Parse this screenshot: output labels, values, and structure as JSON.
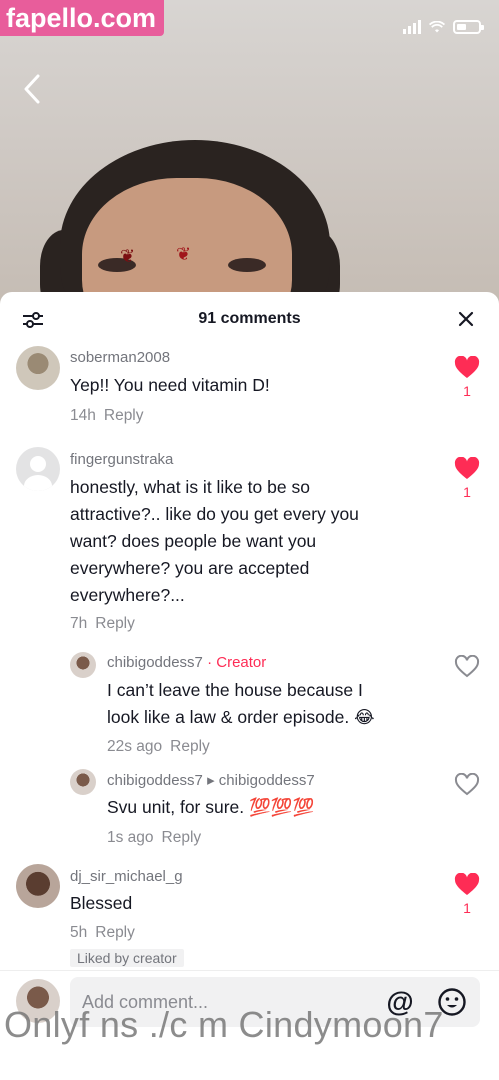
{
  "watermark_top": "fapello.com",
  "watermark_bottom": "Onlyf ns ./c m Cindymoon7",
  "header": {
    "title": "91 comments"
  },
  "comments": [
    {
      "username": "soberman2008",
      "text_lines": [
        "Yep!! You need vitamin D!"
      ],
      "time": "14h",
      "reply": "Reply",
      "likes": "1"
    },
    {
      "username": "fingergunstraka",
      "text_lines": [
        "honestly, what is it like to be so",
        "attractive?.. like do you get every you",
        "want? does people be want you",
        "everywhere? you are accepted",
        "everywhere?..."
      ],
      "time": "7h",
      "reply": "Reply",
      "likes": "1"
    },
    {
      "username": "dj_sir_michael_g",
      "text_lines": [
        "Blessed"
      ],
      "time": "5h",
      "reply": "Reply",
      "likes": "1",
      "badge": "Liked by creator"
    }
  ],
  "replies": [
    {
      "username": "chibigoddess7",
      "separator": " · ",
      "tag": "Creator",
      "text_lines": [
        "I can’t leave the house because I",
        "look like a law & order episode. 😂"
      ],
      "time": "22s ago",
      "reply": "Reply"
    },
    {
      "username": "chibigoddess7",
      "arrow": " ▸ ",
      "reply_to": "chibigoddess7",
      "text_lines": [
        "Svu unit, for sure. 💯💯💯"
      ],
      "time": "1s ago",
      "reply": "Reply"
    }
  ],
  "input": {
    "placeholder": "Add comment..."
  },
  "colors": {
    "accent": "#fe2c55",
    "watermark_bg": "#e85d9b"
  },
  "icons": [
    "back-chevron-icon",
    "filter-icon",
    "close-icon",
    "heart-filled-icon",
    "heart-outline-icon",
    "at-mention-icon",
    "emoji-icon"
  ]
}
